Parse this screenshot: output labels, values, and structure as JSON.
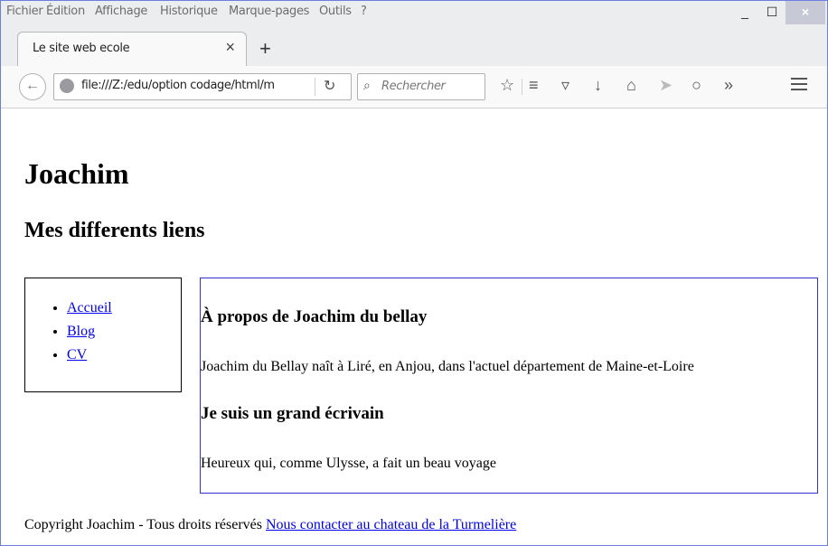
{
  "menubar": {
    "items": [
      "Fichier",
      "Édition",
      "Affichage",
      "Historique",
      "Marque-pages",
      "Outils",
      "?"
    ],
    "minimize": "_",
    "maximize": "☐",
    "close": "×"
  },
  "tab": {
    "title": "Le site web ecole",
    "close": "×",
    "new_tab": "+"
  },
  "navbar": {
    "url": "file:///Z:/edu/option codage/html/m",
    "search_placeholder": "Rechercher",
    "overflow": "»"
  },
  "page": {
    "title": "Joachim",
    "subtitle": "Mes differents liens",
    "nav_links": [
      "Accueil",
      "Blog",
      "CV"
    ],
    "section1_heading": "À propos de Joachim du bellay",
    "section1_text": "Joachim du Bellay naît à Liré, en Anjou, dans l'actuel département de Maine-et-Loire",
    "section2_heading": "Je suis un grand écrivain",
    "section2_text": "Heureux qui, comme Ulysse, a fait un beau voyage",
    "footer_text": "Copyright Joachim - Tous droits réservés",
    "footer_link": "Nous contacter au chateau de la Turmelière"
  },
  "colors": {
    "link": "#0000ee",
    "window_border": "#6c7ee0",
    "main_border": "#3232cc"
  }
}
